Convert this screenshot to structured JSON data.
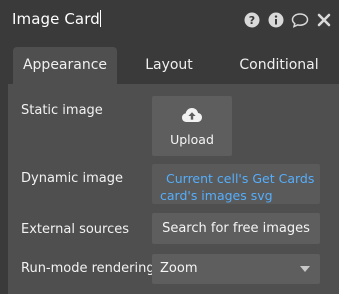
{
  "header": {
    "title": "Image Card",
    "icons": [
      "help-circle-icon",
      "info-circle-icon",
      "comment-icon",
      "close-icon"
    ]
  },
  "tabs": [
    {
      "label": "Appearance",
      "active": true
    },
    {
      "label": "Layout",
      "active": false
    },
    {
      "label": "Conditional",
      "active": false
    }
  ],
  "fields": {
    "static_image": {
      "label": "Static image",
      "button_label": "Upload",
      "icon": "cloud-upload-icon"
    },
    "dynamic_image": {
      "label": "Dynamic image",
      "value_line1": "Current cell's Get Cards",
      "value_line2": "card's images svg"
    },
    "external_sources": {
      "label": "External sources",
      "button_label": "Search for free images"
    },
    "run_mode_rendering": {
      "label": "Run-mode rendering",
      "value": "Zoom"
    }
  },
  "colors": {
    "background": "#3a3a3a",
    "panel": "#4f4f4f",
    "control": "#5e5e5e",
    "dynamic_text": "#55aefc"
  }
}
